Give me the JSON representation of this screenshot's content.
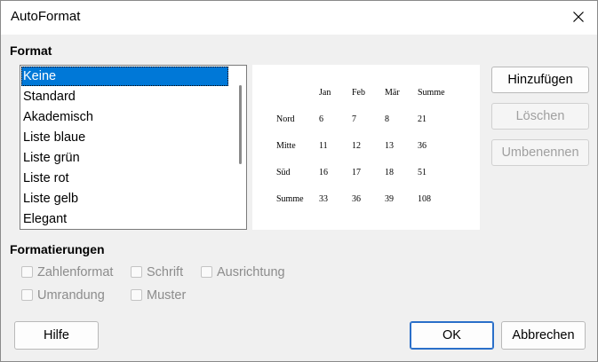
{
  "window": {
    "title": "AutoFormat"
  },
  "format_section": {
    "label": "Format",
    "items": [
      "Keine",
      "Standard",
      "Akademisch",
      "Liste blaue",
      "Liste grün",
      "Liste rot",
      "Liste gelb",
      "Elegant"
    ],
    "selected_index": 0
  },
  "preview": {
    "columns": [
      "Jan",
      "Feb",
      "Mär",
      "Summe"
    ],
    "rows": [
      {
        "label": "Nord",
        "values": [
          "6",
          "7",
          "8",
          "21"
        ]
      },
      {
        "label": "Mitte",
        "values": [
          "11",
          "12",
          "13",
          "36"
        ]
      },
      {
        "label": "Süd",
        "values": [
          "16",
          "17",
          "18",
          "51"
        ]
      },
      {
        "label": "Summe",
        "values": [
          "33",
          "36",
          "39",
          "108"
        ]
      }
    ]
  },
  "side_buttons": {
    "add": "Hinzufügen",
    "delete": "Löschen",
    "rename": "Umbenennen"
  },
  "formatierungen": {
    "label": "Formatierungen",
    "options": [
      {
        "label": "Zahlenformat",
        "checked": false,
        "enabled": false
      },
      {
        "label": "Schrift",
        "checked": false,
        "enabled": false
      },
      {
        "label": "Ausrichtung",
        "checked": false,
        "enabled": false
      },
      {
        "label": "Umrandung",
        "checked": false,
        "enabled": false
      },
      {
        "label": "Muster",
        "checked": false,
        "enabled": false
      }
    ]
  },
  "bottom_buttons": {
    "help": "Hilfe",
    "ok": "OK",
    "cancel": "Abbrechen"
  },
  "colors": {
    "selection": "#0078d7",
    "default_button_border": "#2a6fc9",
    "disabled_text": "#a0a0a0"
  }
}
